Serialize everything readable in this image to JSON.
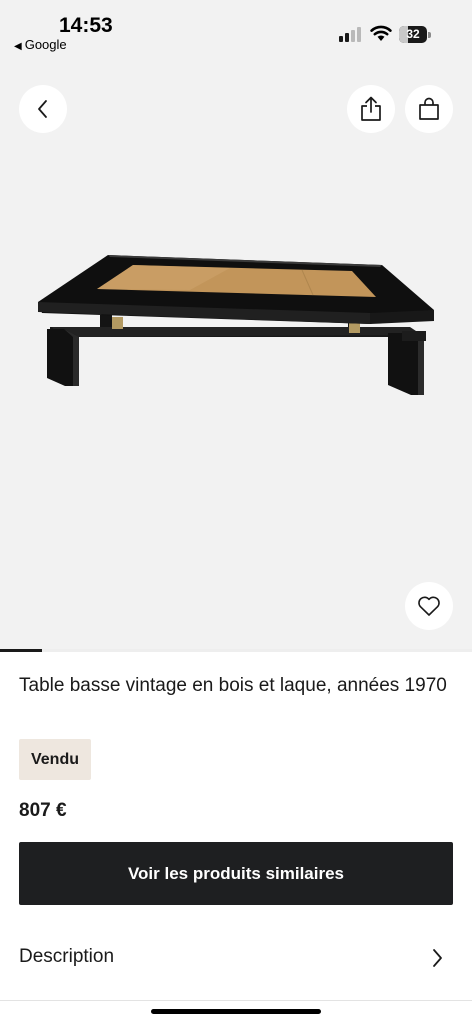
{
  "status_bar": {
    "time": "14:53",
    "back_app": "Google",
    "back_glyph": "◀",
    "battery": "32",
    "battery_level": 0.32
  },
  "product": {
    "title": "Table basse vintage en bois et laque, années 1970",
    "status": "Vendu",
    "price": "807 €",
    "image_count_progress": 0.09
  },
  "actions": {
    "similar_button": "Voir les produits similaires"
  },
  "description": {
    "label": "Description"
  },
  "icons": {
    "back": "chevron-left-icon",
    "share": "share-icon",
    "bag": "shopping-bag-icon",
    "favorite": "heart-icon",
    "description": "chevron-right-icon"
  },
  "colors": {
    "background": "#f2f2f2",
    "badge_background": "#eee7df",
    "button_background": "#1e1f21",
    "text": "#1a1a1a"
  }
}
